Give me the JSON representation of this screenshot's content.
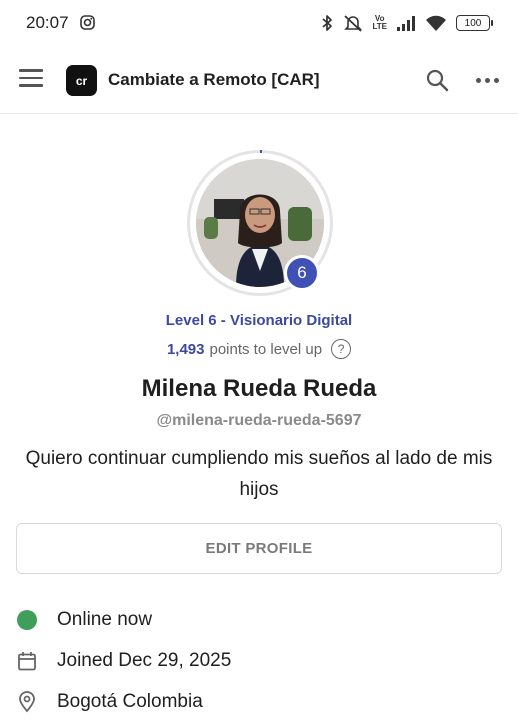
{
  "status_bar": {
    "time": "20:07",
    "battery": "100",
    "volte_top": "Vo",
    "volte_bottom": "LTE",
    "icons": [
      "instagram-icon",
      "bluetooth-icon",
      "mute-icon",
      "signal-icon",
      "wifi-icon",
      "battery-icon"
    ]
  },
  "header": {
    "logo_text": "cr",
    "title": "Cambiate a Remoto [CAR]",
    "icons": [
      "menu-icon",
      "search-icon",
      "more-icon"
    ]
  },
  "profile": {
    "level_number": "6",
    "level_text": "Level 6 - Visionario Digital",
    "points": "1,493",
    "points_suffix": "points to level up",
    "help_symbol": "?",
    "name": "Milena Rueda Rueda",
    "handle": "@milena-rueda-rueda-5697",
    "bio": "Quiero continuar cumpliendo mis sueños al lado de mis hijos",
    "edit_label": "EDIT PROFILE"
  },
  "details": {
    "status": "Online now",
    "joined": "Joined Dec 29, 2025",
    "location": "Bogotá Colombia"
  },
  "colors": {
    "accent": "#3b4aa0",
    "badge": "#3f51b5",
    "online": "#3f9e5a"
  }
}
